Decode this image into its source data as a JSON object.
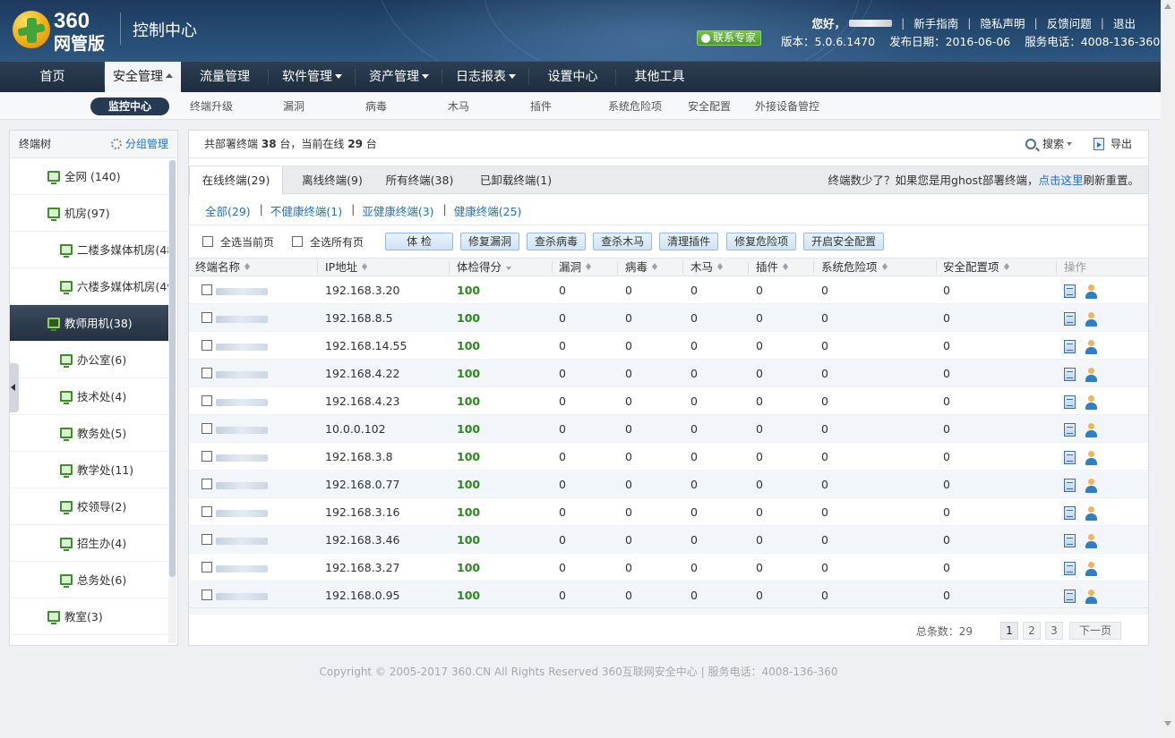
{
  "header": {
    "logo_top": "360",
    "logo_bottom": "网管版",
    "title": "控制中心",
    "greeting": "您好，",
    "links": [
      "新手指南",
      "隐私声明",
      "反馈问题",
      "退出"
    ],
    "expert_button": "联系专家",
    "version": "版本：5.0.6.1470",
    "release_date": "发布日期：2016-06-06",
    "service_phone": "服务电话：4008-136-360"
  },
  "nav": {
    "items": [
      {
        "label": "首页",
        "dropdown": false
      },
      {
        "label": "安全管理",
        "dropdown": true,
        "active": true
      },
      {
        "label": "流量管理",
        "dropdown": false
      },
      {
        "label": "软件管理",
        "dropdown": true
      },
      {
        "label": "资产管理",
        "dropdown": true
      },
      {
        "label": "日志报表",
        "dropdown": true
      },
      {
        "label": "设置中心",
        "dropdown": false
      },
      {
        "label": "其他工具",
        "dropdown": false
      }
    ]
  },
  "subnav": {
    "items": [
      "监控中心",
      "终端升级",
      "漏洞",
      "病毒",
      "木马",
      "插件",
      "系统危险项",
      "安全配置",
      "外接设备管控"
    ],
    "active_index": 0
  },
  "tree": {
    "title": "终端树",
    "group_manage": "分组管理",
    "items": [
      {
        "label": "全网 (140)",
        "level": 1
      },
      {
        "label": "机房(97)",
        "level": 1
      },
      {
        "label": "二楼多媒体机房(48",
        "level": 2
      },
      {
        "label": "六楼多媒体机房(49",
        "level": 2
      },
      {
        "label": "教师用机(38)",
        "level": 1,
        "selected": true
      },
      {
        "label": "办公室(6)",
        "level": 2
      },
      {
        "label": "技术处(4)",
        "level": 2
      },
      {
        "label": "教务处(5)",
        "level": 2
      },
      {
        "label": "教学处(11)",
        "level": 2
      },
      {
        "label": "校领导(2)",
        "level": 2
      },
      {
        "label": "招生办(4)",
        "level": 2
      },
      {
        "label": "总务处(6)",
        "level": 2
      },
      {
        "label": "教室(3)",
        "level": 1
      }
    ]
  },
  "summary": {
    "prefix": "共部署终端",
    "total": "38",
    "mid": "台，当前在线",
    "online": "29",
    "suffix": "台",
    "search_label": "搜索",
    "export_label": "导出"
  },
  "tabs": {
    "items": [
      "在线终端(29)",
      "离线终端(9)",
      "所有终端(38)",
      "已卸载终端(1)"
    ],
    "active_index": 0,
    "note_prefix": "终端数少了？如果您是用ghost部署终端，",
    "note_link": "点击这里",
    "note_suffix": "刷新重置。"
  },
  "filters": [
    "全部(29)",
    "不健康终端(1)",
    "亚健康终端(3)",
    "健康终端(25)"
  ],
  "toolbar": {
    "select_page": "全选当前页",
    "select_all": "全选所有页",
    "buttons": [
      "体 检",
      "修复漏洞",
      "查杀病毒",
      "查杀木马",
      "清理插件",
      "修复危险项",
      "开启安全配置"
    ]
  },
  "table": {
    "columns": [
      "终端名称",
      "IP地址",
      "体检得分",
      "漏洞",
      "病毒",
      "木马",
      "插件",
      "系统危险项",
      "安全配置项",
      "操作"
    ],
    "rows": [
      {
        "ip": "192.168.3.20",
        "score": "100",
        "vuln": "0",
        "virus": "0",
        "trojan": "0",
        "plugin": "0",
        "risk": "0",
        "config": "0"
      },
      {
        "ip": "192.168.8.5",
        "score": "100",
        "vuln": "0",
        "virus": "0",
        "trojan": "0",
        "plugin": "0",
        "risk": "0",
        "config": "0"
      },
      {
        "ip": "192.168.14.55",
        "score": "100",
        "vuln": "0",
        "virus": "0",
        "trojan": "0",
        "plugin": "0",
        "risk": "0",
        "config": "0"
      },
      {
        "ip": "192.168.4.22",
        "score": "100",
        "vuln": "0",
        "virus": "0",
        "trojan": "0",
        "plugin": "0",
        "risk": "0",
        "config": "0"
      },
      {
        "ip": "192.168.4.23",
        "score": "100",
        "vuln": "0",
        "virus": "0",
        "trojan": "0",
        "plugin": "0",
        "risk": "0",
        "config": "0"
      },
      {
        "ip": "10.0.0.102",
        "score": "100",
        "vuln": "0",
        "virus": "0",
        "trojan": "0",
        "plugin": "0",
        "risk": "0",
        "config": "0"
      },
      {
        "ip": "192.168.3.8",
        "score": "100",
        "vuln": "0",
        "virus": "0",
        "trojan": "0",
        "plugin": "0",
        "risk": "0",
        "config": "0"
      },
      {
        "ip": "192.168.0.77",
        "score": "100",
        "vuln": "0",
        "virus": "0",
        "trojan": "0",
        "plugin": "0",
        "risk": "0",
        "config": "0"
      },
      {
        "ip": "192.168.3.16",
        "score": "100",
        "vuln": "0",
        "virus": "0",
        "trojan": "0",
        "plugin": "0",
        "risk": "0",
        "config": "0"
      },
      {
        "ip": "192.168.3.46",
        "score": "100",
        "vuln": "0",
        "virus": "0",
        "trojan": "0",
        "plugin": "0",
        "risk": "0",
        "config": "0"
      },
      {
        "ip": "192.168.3.27",
        "score": "100",
        "vuln": "0",
        "virus": "0",
        "trojan": "0",
        "plugin": "0",
        "risk": "0",
        "config": "0"
      },
      {
        "ip": "192.168.0.95",
        "score": "100",
        "vuln": "0",
        "virus": "0",
        "trojan": "0",
        "plugin": "0",
        "risk": "0",
        "config": "0"
      }
    ]
  },
  "pager": {
    "total_label": "总条数：29",
    "pages": [
      "1",
      "2",
      "3"
    ],
    "current": "1",
    "next_label": "下一页"
  },
  "footer": {
    "copyright": "Copyright © 2005-2017 360.CN All Rights Reserved 360互联网安全中心 | 服务电话：4008-136-360"
  },
  "colors": {
    "score_green": "#2a8a1b",
    "link_blue": "#1c74c9",
    "nav_dark": "#1e2d3e",
    "expert_green": "#4e9d2e"
  }
}
